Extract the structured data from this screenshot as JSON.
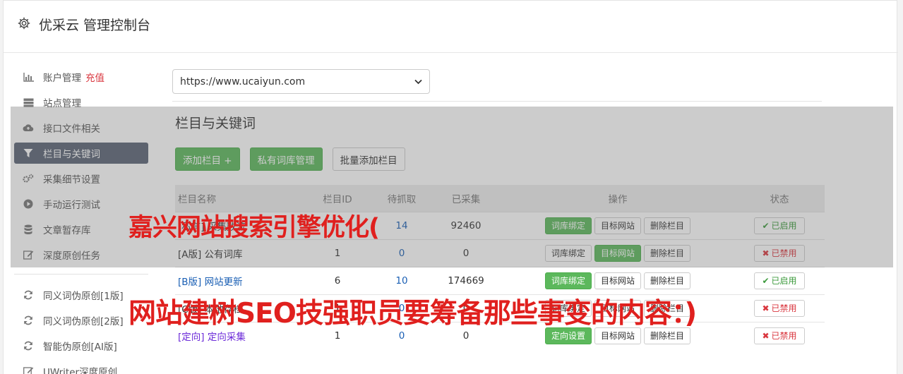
{
  "header": {
    "title": "优采云 管理控制台",
    "icon": "gear-icon"
  },
  "sidebar": {
    "items": [
      {
        "label": "账户管理",
        "extra": "充值",
        "icon": "bar-chart-icon"
      },
      {
        "label": "站点管理",
        "icon": "server-icon"
      },
      {
        "label": "接口文件相关",
        "icon": "cloud-upload-icon"
      },
      {
        "label": "栏目与关键词",
        "icon": "filter-icon",
        "active": true
      },
      {
        "label": "采集细节设置",
        "icon": "gears-icon"
      },
      {
        "label": "手动运行测试",
        "icon": "play-circle-icon"
      },
      {
        "label": "文章暂存库",
        "icon": "database-icon"
      },
      {
        "label": "深度原创任务",
        "icon": "edit-icon"
      }
    ],
    "items2": [
      {
        "label": "同义词伪原创[1版]",
        "icon": "refresh-icon"
      },
      {
        "label": "同义词伪原创[2版]",
        "icon": "refresh-icon"
      },
      {
        "label": "智能伪原创[AI版]",
        "icon": "refresh-icon"
      },
      {
        "label": "UWriter深度原创",
        "icon": "edit-icon"
      }
    ]
  },
  "main": {
    "site_select": {
      "value": "https://www.ucaiyun.com"
    },
    "section_title": "栏目与关键词",
    "buttons": {
      "add": "添加栏目 +",
      "private": "私有词库管理",
      "batch": "批量添加栏目"
    },
    "table": {
      "headers": [
        "栏目名称",
        "栏目ID",
        "待抓取",
        "已采集",
        "操作",
        "状态"
      ],
      "rows": [
        {
          "name": "[私有] 采集数流",
          "id": "",
          "pending": "14",
          "collected": "92460",
          "ops": [
            "词库绑定",
            "目标网站",
            "删除栏目"
          ],
          "status": "已启用"
        },
        {
          "name": "[A版] 公有词库",
          "id": "1",
          "pending": "0",
          "collected": "0",
          "ops": [
            "词库绑定",
            "目标网站",
            "删除栏目"
          ],
          "status": "已禁用"
        },
        {
          "name": "[B版] 网站更新",
          "id": "6",
          "pending": "10",
          "collected": "174669",
          "ops": [
            "词库绑定",
            "目标网站",
            "删除栏目"
          ],
          "status": "已启用"
        },
        {
          "name": "[C版] 本地存档",
          "id": "1",
          "pending": "0",
          "collected": "0",
          "ops": [
            "词库绑定",
            "目标网站",
            "删除栏目"
          ],
          "status": "已禁用"
        },
        {
          "name": "[定向] 定向采集",
          "id": "1",
          "pending": "0",
          "collected": "0",
          "ops": [
            "定向设置",
            "目标网站",
            "删除栏目"
          ],
          "status": "已禁用"
        }
      ]
    }
  },
  "overlay_text": {
    "line1": "嘉兴网站搜索引擎优化(",
    "line2": "网站建树SEO技强职员要筹备那些事变的内容：)"
  },
  "colors": {
    "accent_green": "#5cb85c",
    "active_sidebar": "#5a6375",
    "danger": "#d9363e",
    "overlay_red": "#e0201e"
  }
}
